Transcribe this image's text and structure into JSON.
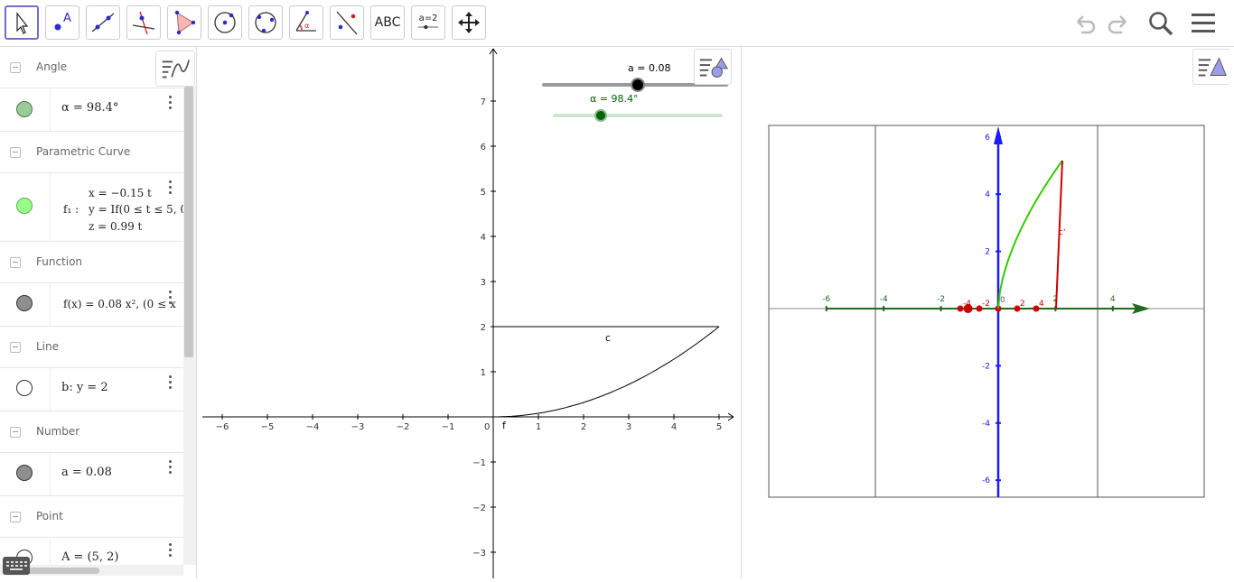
{
  "toolbar": {
    "tools": [
      {
        "name": "move"
      },
      {
        "name": "point"
      },
      {
        "name": "line"
      },
      {
        "name": "perpendicular-line"
      },
      {
        "name": "polygon"
      },
      {
        "name": "circle-center-point"
      },
      {
        "name": "circle-three-points"
      },
      {
        "name": "angle"
      },
      {
        "name": "reflect-about-line"
      },
      {
        "name": "text",
        "label": "ABC"
      },
      {
        "name": "slider",
        "label": "a=2"
      },
      {
        "name": "move-graphics-view"
      }
    ]
  },
  "algebra": {
    "groups": [
      {
        "header": "Angle",
        "rows": [
          {
            "value": "α = 98.4°",
            "color": "#99cc99"
          }
        ]
      },
      {
        "header": "Parametric Curve",
        "rows": [
          {
            "prefix": "f₁ :",
            "lines": [
              "x = −0.15 t",
              "y = If(0 ≤ t ≤ 5, 0",
              "z = 0.99 t"
            ],
            "color": "#99ff88"
          }
        ]
      },
      {
        "header": "Function",
        "rows": [
          {
            "value": "f(x) = 0.08 x²,   (0 ≤ x",
            "color": "#8e8e8e"
          }
        ]
      },
      {
        "header": "Line",
        "rows": [
          {
            "value": "b: y = 2",
            "color": "#ffffff"
          }
        ]
      },
      {
        "header": "Number",
        "rows": [
          {
            "value": "a = 0.08",
            "color": "#8e8e8e"
          }
        ]
      },
      {
        "header": "Point",
        "rows": [
          {
            "value": "A = (5, 2)",
            "color": "#ffffff"
          }
        ]
      }
    ]
  },
  "graphics1": {
    "slider_a_label": "a = 0.08",
    "slider_alpha_label": "α = 98.4°",
    "curve_label": "c",
    "function_label": "f",
    "x_ticks": [
      "-6",
      "-5",
      "-4",
      "-3",
      "-2",
      "-1",
      "0",
      "1",
      "2",
      "3",
      "4",
      "5"
    ],
    "y_ticks": [
      "7",
      "6",
      "5",
      "4",
      "3",
      "2",
      "1",
      "-1",
      "-2",
      "-3"
    ]
  },
  "graphics2": {
    "x_ticks": [
      "-6",
      "-4",
      "-2",
      "2",
      "4"
    ],
    "y_ticks": [
      "6",
      "4",
      "2",
      "-2",
      "-4",
      "-6"
    ],
    "red_ticks": [
      "-4",
      "-2",
      "2",
      "4"
    ],
    "origin_label": "0",
    "curve_label": "c'"
  },
  "colors": {
    "accent": "#6b72c7",
    "green_axis": "#1e6b1e",
    "blue_axis": "#1a1aff",
    "red": "#cc0000",
    "curve_green": "#33cc00"
  }
}
